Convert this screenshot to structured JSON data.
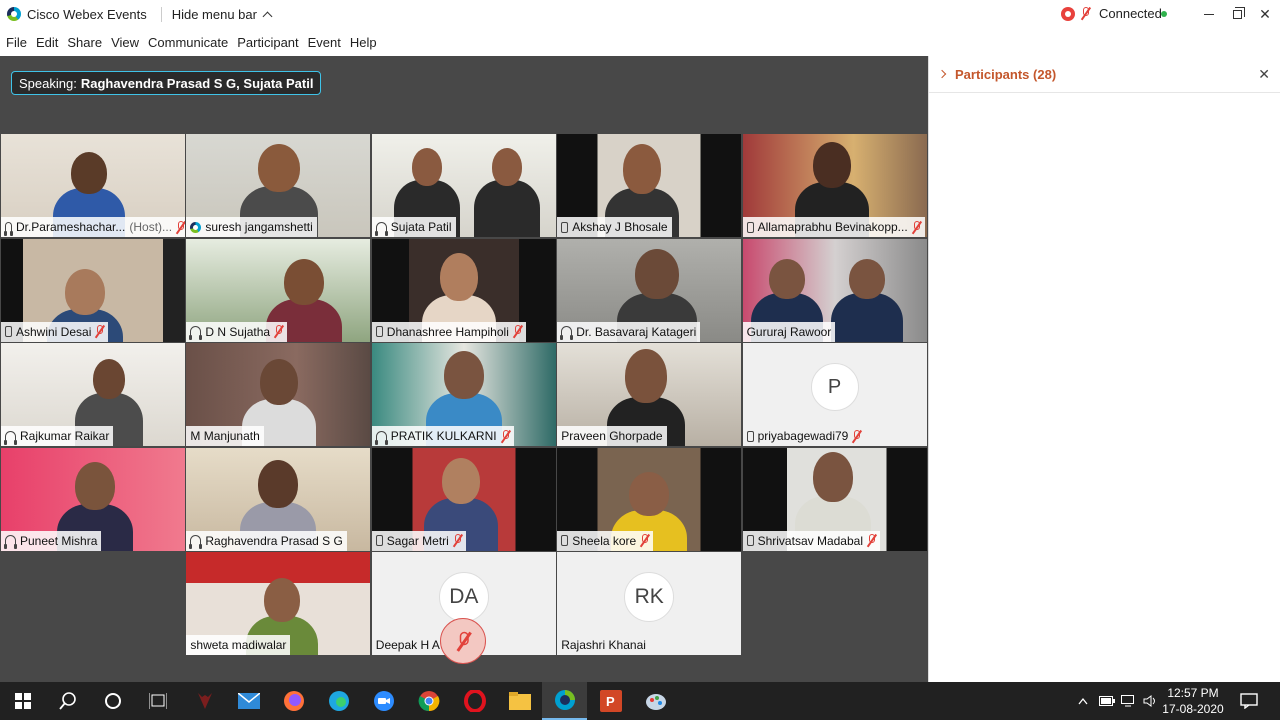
{
  "titlebar": {
    "app_title": "Cisco Webex Events",
    "hide_menu_label": "Hide menu bar",
    "connection_status": "Connected",
    "status_color": "#2fb24c"
  },
  "menu": [
    "File",
    "Edit",
    "Share",
    "View",
    "Communicate",
    "Participant",
    "Event",
    "Help"
  ],
  "stage": {
    "speaking_prefix": "Speaking:",
    "speaking_names": "Raghavendra Prasad S G, Sujata Patil",
    "accent": "#36b7e3"
  },
  "tiles": [
    {
      "name": "Dr.Parameshachar...",
      "host": "(Host)...",
      "icon": "audio-icon",
      "muted": true
    },
    {
      "name": "suresh jangamshetti",
      "icon": "webex-icon",
      "muted": false
    },
    {
      "name": "Sujata Patil",
      "icon": "audio-icon",
      "muted": false,
      "active": true
    },
    {
      "name": "Akshay J Bhosale",
      "icon": "phone-icon",
      "muted": false
    },
    {
      "name": "Allamaprabhu Bevinakopp...",
      "icon": "phone-icon",
      "muted": true
    },
    {
      "name": "Ashwini Desai",
      "icon": "phone-icon",
      "muted": true
    },
    {
      "name": "D N Sujatha",
      "icon": "audio-icon",
      "muted": true
    },
    {
      "name": "Dhanashree Hampiholi",
      "icon": "phone-icon",
      "muted": true
    },
    {
      "name": "Dr. Basavaraj Katageri",
      "icon": "audio-icon",
      "muted": false
    },
    {
      "name": "Gururaj Rawoor",
      "icon": "",
      "muted": false
    },
    {
      "name": "Rajkumar Raikar",
      "icon": "audio-icon",
      "muted": false
    },
    {
      "name": "M Manjunath",
      "icon": "",
      "muted": false
    },
    {
      "name": "PRATIK KULKARNI",
      "icon": "audio-icon",
      "muted": true
    },
    {
      "name": "Praveen Ghorpade",
      "icon": "",
      "muted": false
    },
    {
      "name": "priyabagewadi79",
      "icon": "phone-icon",
      "muted": true,
      "avatar": "P"
    },
    {
      "name": "Puneet Mishra",
      "icon": "audio-icon",
      "muted": false
    },
    {
      "name": "Raghavendra Prasad S G",
      "icon": "audio-icon",
      "muted": false,
      "active": true
    },
    {
      "name": "Sagar Metri",
      "icon": "phone-icon",
      "muted": true
    },
    {
      "name": "Sheela kore",
      "icon": "phone-icon",
      "muted": true
    },
    {
      "name": "Shrivatsav Madabal",
      "icon": "phone-icon",
      "muted": true
    },
    {
      "name": "shweta madiwalar",
      "icon": "",
      "muted": false
    },
    {
      "name": "Deepak H A",
      "icon": "",
      "muted": false,
      "avatar": "DA"
    },
    {
      "name": "Rajashri Khanai",
      "icon": "",
      "muted": false,
      "avatar": "RK"
    }
  ],
  "panel": {
    "title": "Participants (28)",
    "accent": "#c4572c"
  },
  "taskbar": {
    "apps": [
      "start-icon",
      "search-icon",
      "cortana-icon",
      "task-view-icon",
      "game-icon",
      "mail-icon",
      "firefox-icon",
      "edge-icon",
      "zoom-icon",
      "chrome-icon",
      "opera-icon",
      "file-explorer-icon",
      "webex-icon",
      "powerpoint-icon",
      "paint-icon"
    ],
    "time": "12:57 PM",
    "date": "17-08-2020"
  }
}
